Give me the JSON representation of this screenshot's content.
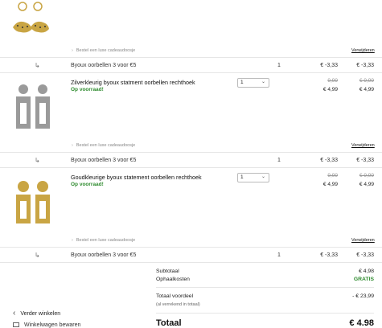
{
  "items": [
    {
      "gift_label": "Bestel een luxe cadeaudoosje",
      "remove_label": "Verwijderen",
      "discount_label": "Byoux oorbellen 3 voor €5",
      "discount_qty": "1",
      "discount_unit": "€ -3,33",
      "discount_total": "€ -3,33"
    },
    {
      "name": "Zilverkleurig byoux statment oorbellen rechthoek",
      "stock": "Op voorraad!",
      "qty": "1",
      "old_unit": "9,99",
      "unit": "€ 4,99",
      "old_total": "€ 9,99",
      "total": "€ 4,99",
      "gift_label": "Bestel een luxe cadeaudoosje",
      "remove_label": "Verwijderen",
      "discount_label": "Byoux oorbellen 3 voor €5",
      "discount_qty": "1",
      "discount_unit": "€ -3,33",
      "discount_total": "€ -3,33"
    },
    {
      "name": "Goudkleurige byoux statement oorbellen rechthoek",
      "stock": "Op voorraad!",
      "qty": "1",
      "old_unit": "9,99",
      "unit": "€ 4,99",
      "old_total": "€ 9,99",
      "total": "€ 4,99",
      "gift_label": "Bestel een luxe cadeaudoosje",
      "remove_label": "Verwijderen",
      "discount_label": "Byoux oorbellen 3 voor €5",
      "discount_qty": "1",
      "discount_unit": "€ -3,33",
      "discount_total": "€ -3,33"
    }
  ],
  "summary": {
    "subtotal_label": "Subtotaal",
    "subtotal": "€ 4,98",
    "shipping_label": "Ophaalkosten",
    "shipping": "GRATIS",
    "savings_label": "Totaal voordeel",
    "savings_note": "(al verrekend in totaal)",
    "savings": "- € 23,99",
    "total_label": "Totaal",
    "total": "€ 4.98"
  },
  "footer": {
    "continue_label": "Verder winkelen",
    "wishlist_label": "Winkelwagen bewaren"
  },
  "colors": {
    "accent_green": "#2e8b2e",
    "gold": "#c9a544",
    "silver": "#9a9a9a"
  }
}
